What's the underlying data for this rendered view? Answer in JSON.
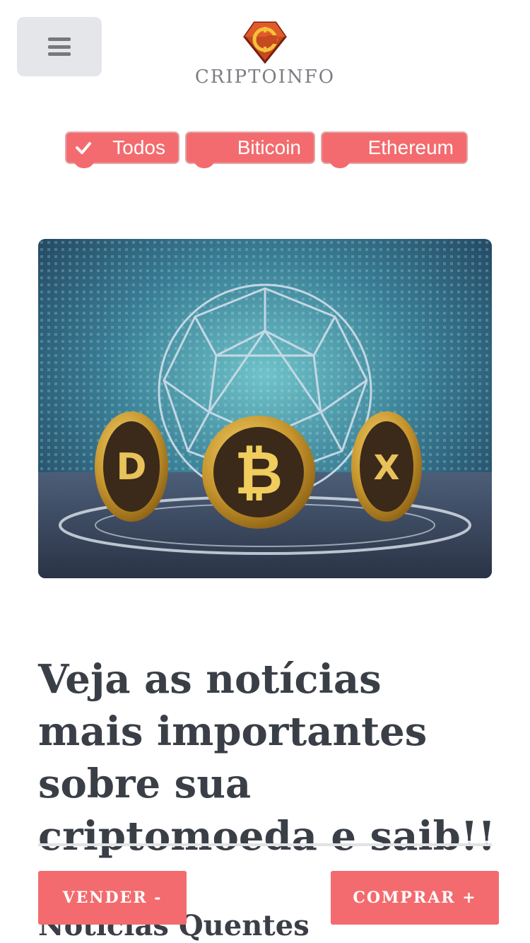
{
  "header": {
    "brand_name": "CRIPTOINFO",
    "menu_icon": "hamburger-icon",
    "logo_icon": "criptoinfo-logo-icon"
  },
  "filters": [
    {
      "label": "Todos",
      "checked": true
    },
    {
      "label": "Biticoin",
      "checked": false
    },
    {
      "label": "Ethereum",
      "checked": false
    }
  ],
  "hero": {
    "description_icon": "crypto-coins-illustration"
  },
  "headline": "Veja as notícias mais importantes sobre sua criptomoeda e saib!!",
  "section_title": "Notícias Quentes",
  "actions": {
    "sell_label": "VENDER -",
    "buy_label": "COMPRAR +"
  },
  "colors": {
    "accent": "#f36b6e",
    "text_dark": "#3a3f47",
    "menu_bg": "#e4e6e9"
  }
}
